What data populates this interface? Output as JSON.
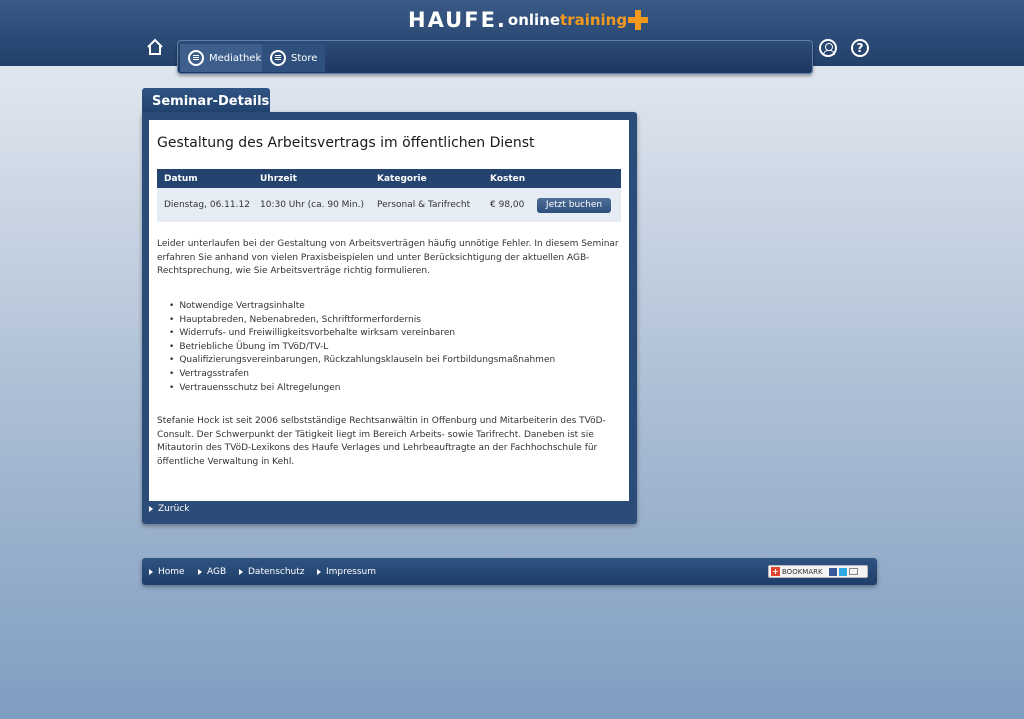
{
  "header": {
    "logo_brand": "HAUFE.",
    "logo_online": "online",
    "logo_training": "training",
    "nav": [
      {
        "label": "Mediathek",
        "icon": "list-icon"
      },
      {
        "label": "Store",
        "icon": "list-icon"
      }
    ],
    "help_symbol": "?"
  },
  "panel": {
    "tab_title": "Seminar-Details",
    "seminar_title": "Gestaltung des Arbeitsvertrags im öffentlichen Dienst",
    "table": {
      "headers": [
        "Datum",
        "Uhrzeit",
        "Kategorie",
        "Kosten"
      ],
      "row": [
        "Dienstag, 06.11.12",
        "10:30 Uhr (ca. 90 Min.)",
        "Personal & Tarifrecht",
        "€ 98,00"
      ],
      "button_label": "Jetzt buchen"
    },
    "intro": "Leider unterlaufen bei der Gestaltung von Arbeitsverträgen häufig unnötige Fehler. In diesem Seminar erfahren Sie anhand von vielen Praxisbeispielen und unter Berücksichtigung der aktuellen AGB-Rechtsprechung, wie Sie Arbeitsverträge richtig formulieren.",
    "topics": [
      "Notwendige Vertragsinhalte",
      "Hauptabreden, Nebenabreden, Schriftformerfordernis",
      "Widerrufs- und Freiwilligkeitsvorbehalte wirksam vereinbaren",
      "Betriebliche Übung im TVöD/TV-L",
      "Qualifizierungsvereinbarungen, Rückzahlungsklauseln bei Fortbildungsmaßnahmen",
      "Vertragsstrafen",
      "Vertrauensschutz bei Altregelungen"
    ],
    "bio": "Stefanie Hock ist seit 2006 selbstständige Rechtsanwältin in Offenburg und Mitarbeiterin des TVöD-Consult. Der Schwerpunkt der Tätigkeit liegt im Bereich Arbeits- sowie Tarifrecht. Daneben ist sie Mitautorin des TVöD-Lexikons des Haufe Verlages und Lehrbeauftragte an der Fachhochschule für öffentliche Verwaltung in Kehl.",
    "back_label": "Zurück"
  },
  "footer": {
    "links": [
      "Home",
      "AGB",
      "Datenschutz",
      "Impressum"
    ],
    "bookmark_label": "BOOKMARK"
  },
  "colors": {
    "header_bg": "#2c4b76",
    "accent_orange": "#f39a1e",
    "panel_bg": "#2b4c79"
  }
}
